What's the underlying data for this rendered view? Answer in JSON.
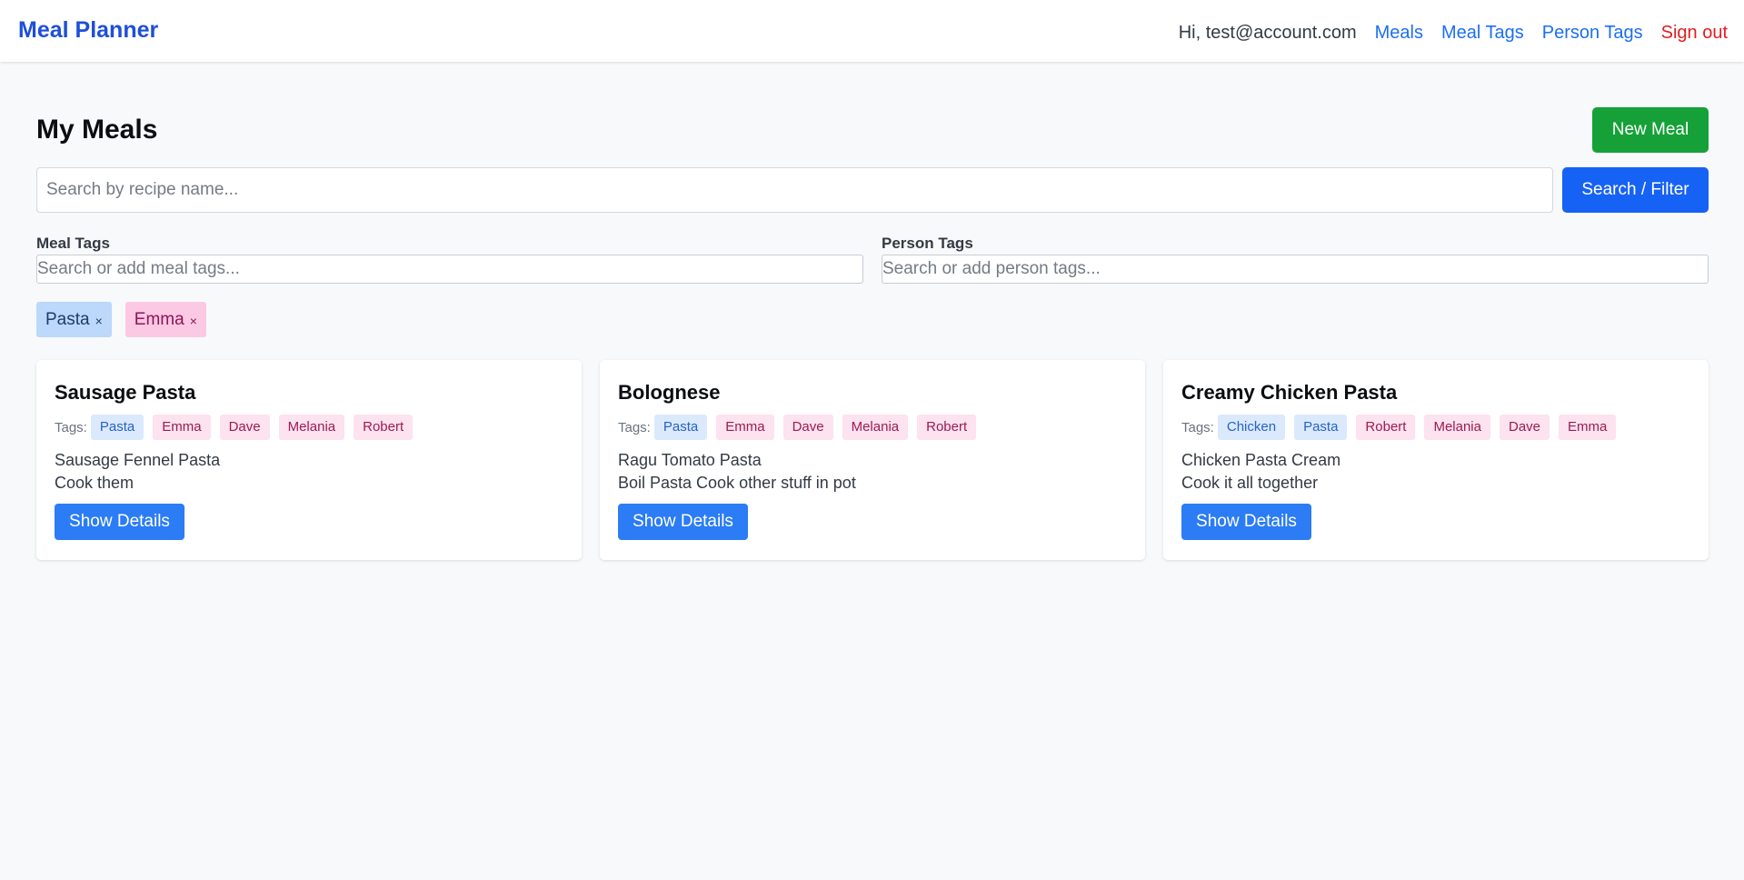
{
  "navbar": {
    "brand": "Meal Planner",
    "greeting": "Hi, test@account.com",
    "links": [
      "Meals",
      "Meal Tags",
      "Person Tags"
    ],
    "signout": "Sign out"
  },
  "page": {
    "title": "My Meals",
    "new_meal_label": "New Meal",
    "search_placeholder": "Search by recipe name...",
    "search_button": "Search / Filter",
    "meal_tags_label": "Meal Tags",
    "meal_tags_placeholder": "Search or add meal tags...",
    "person_tags_label": "Person Tags",
    "person_tags_placeholder": "Search or add person tags...",
    "active_filters": [
      {
        "label": "Pasta",
        "kind": "meal"
      },
      {
        "label": "Emma",
        "kind": "person"
      }
    ],
    "remove_glyph": "×"
  },
  "cards": [
    {
      "title": "Sausage Pasta",
      "tags_label": "Tags:",
      "tags": [
        {
          "label": "Pasta",
          "kind": "meal"
        },
        {
          "label": "Emma",
          "kind": "person"
        },
        {
          "label": "Dave",
          "kind": "person"
        },
        {
          "label": "Melania",
          "kind": "person"
        },
        {
          "label": "Robert",
          "kind": "person"
        }
      ],
      "ingredients": "Sausage Fennel Pasta",
      "instructions": "Cook them",
      "button": "Show Details"
    },
    {
      "title": "Bolognese",
      "tags_label": "Tags:",
      "tags": [
        {
          "label": "Pasta",
          "kind": "meal"
        },
        {
          "label": "Emma",
          "kind": "person"
        },
        {
          "label": "Dave",
          "kind": "person"
        },
        {
          "label": "Melania",
          "kind": "person"
        },
        {
          "label": "Robert",
          "kind": "person"
        }
      ],
      "ingredients": "Ragu Tomato Pasta",
      "instructions": "Boil Pasta Cook other stuff in pot",
      "button": "Show Details"
    },
    {
      "title": "Creamy Chicken Pasta",
      "tags_label": "Tags:",
      "tags": [
        {
          "label": "Chicken",
          "kind": "meal"
        },
        {
          "label": "Pasta",
          "kind": "meal"
        },
        {
          "label": "Robert",
          "kind": "person"
        },
        {
          "label": "Melania",
          "kind": "person"
        },
        {
          "label": "Dave",
          "kind": "person"
        },
        {
          "label": "Emma",
          "kind": "person"
        }
      ],
      "ingredients": "Chicken Pasta Cream",
      "instructions": "Cook it all together",
      "button": "Show Details"
    }
  ],
  "colors": {
    "brand": "#1e4fd8",
    "link": "#1d6ff2",
    "signout": "#e11d1d",
    "new_meal": "#15a137",
    "primary": "#1662f5"
  }
}
